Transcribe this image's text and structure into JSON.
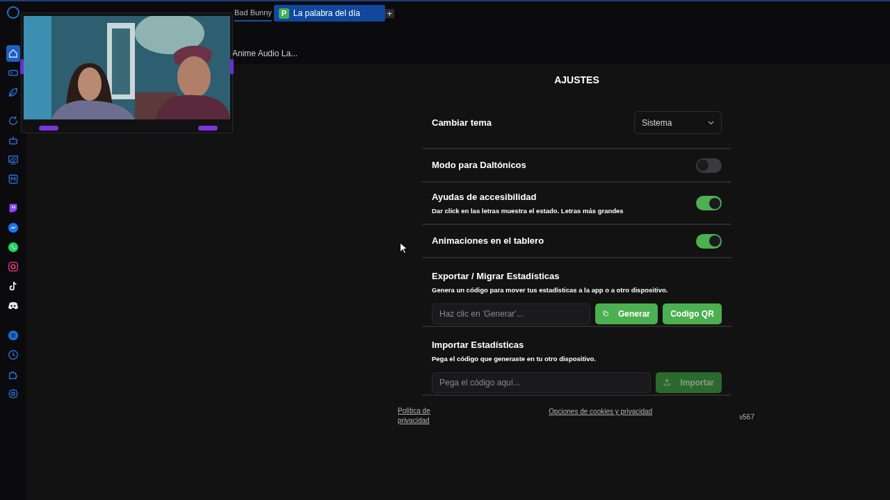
{
  "browser": {
    "tabs": [
      {
        "label": "Bad Bunny",
        "selected": false
      },
      {
        "label": "La palabra del día",
        "favicon": "P",
        "selected": true
      }
    ],
    "new_tab": "+",
    "bookmarks": [
      "Anime Audio La..."
    ]
  },
  "sidebar": {
    "items": [
      {
        "kind": "home",
        "selected": true
      },
      {
        "kind": "gamepad",
        "selected": false
      },
      {
        "kind": "leaf",
        "selected": false
      },
      {
        "kind": "refresh",
        "selected": false
      },
      {
        "kind": "robot",
        "selected": false
      },
      {
        "kind": "stripes",
        "selected": false
      },
      {
        "kind": "mbox",
        "selected": false
      },
      {
        "kind": "twitch",
        "selected": false
      },
      {
        "kind": "messenger",
        "selected": false
      },
      {
        "kind": "whatsapp",
        "selected": false
      },
      {
        "kind": "instagram",
        "selected": false
      },
      {
        "kind": "tiktok",
        "selected": false
      },
      {
        "kind": "discord",
        "selected": false
      },
      {
        "kind": "spotify",
        "selected": false
      },
      {
        "kind": "clock",
        "selected": false
      },
      {
        "kind": "puzzle",
        "selected": false
      },
      {
        "kind": "gear",
        "selected": false
      }
    ]
  },
  "settings": {
    "title": "AJUSTES",
    "rows": [
      {
        "kind": "select",
        "label": "Cambiar tema",
        "value": "Sistema"
      },
      {
        "kind": "toggle",
        "label": "Modo para Daltónicos",
        "on": false
      },
      {
        "kind": "toggle",
        "label": "Ayudas de accesibilidad",
        "description": "Dar click en las letras muestra el estado. Letras más grandes",
        "on": true
      },
      {
        "kind": "toggle",
        "label": "Animaciones en el tablero",
        "on": true
      },
      {
        "kind": "export",
        "label": "Exportar / Migrar Estadísticas",
        "description": "Genera un código para mover tus estadísticas a la app o a otro dispositivo.",
        "placeholder": "Haz clic en 'Generar'...",
        "buttons": [
          {
            "label": "Generar",
            "disabled": false
          },
          {
            "label": "Codigo QR",
            "disabled": false
          }
        ]
      },
      {
        "kind": "import",
        "label": "Importar Estadísticas",
        "description": "Pega el código que generaste en tu otro dispositivo.",
        "placeholder": "Pega el código aquí...",
        "buttons": [
          {
            "label": "Importar",
            "disabled": true
          }
        ]
      }
    ]
  },
  "footer": {
    "privacy_link": "Política de privacidad",
    "cookies_link": "Opciones de cookies y privacidad",
    "version": "v567"
  }
}
